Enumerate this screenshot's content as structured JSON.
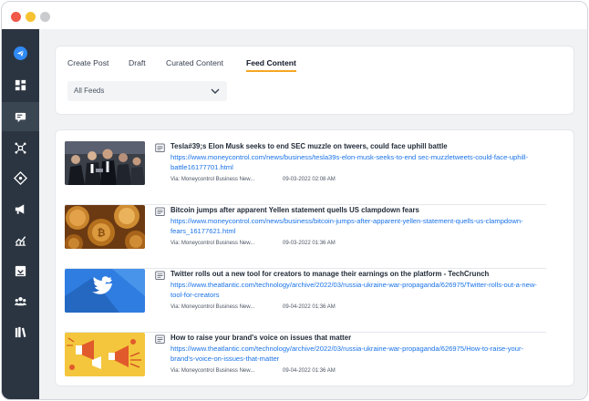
{
  "sidebar": {
    "items": [
      {
        "icon": "paper-plane-icon"
      },
      {
        "icon": "dashboard-icon"
      },
      {
        "icon": "content-icon"
      },
      {
        "icon": "network-icon"
      },
      {
        "icon": "move-icon"
      },
      {
        "icon": "megaphone-icon"
      },
      {
        "icon": "analytics-icon"
      },
      {
        "icon": "inbox-icon"
      },
      {
        "icon": "team-icon"
      },
      {
        "icon": "library-icon"
      }
    ]
  },
  "tabs": [
    {
      "label": "Create Post"
    },
    {
      "label": "Draft"
    },
    {
      "label": "Curated Content"
    },
    {
      "label": "Feed Content"
    }
  ],
  "active_tab": "Feed Content",
  "filter": {
    "selected": "All Feeds"
  },
  "feed": [
    {
      "title": "Tesla#39;s Elon Musk seeks to end SEC muzzle on tweers, could face uphill battle",
      "url": "https://www.moneycontrol.com/news/business/tesla39s-elon-musk-seeks-to-end sec-muzzletweets-could-face-uphill-battle16177701.html",
      "source": "Via: Moneycontrol Business New...",
      "date": "09-03-2022 02:08 AM"
    },
    {
      "title": "Bitcoin jumps after apparent Yellen statement quells US clampdown fears",
      "url": "https://www.moneycontrol.com/news/business/bitcoin-jumps-after-apparent-yellen-statement-quells-us-clampdown-fears_16177621.html",
      "source": "Via: Moneycontrol Business New...",
      "date": "09-03-2022 01:36 AM"
    },
    {
      "title": "Twitter rolls out a new tool for creators to manage their earnings on the platform - TechCrunch",
      "url": "https://www.theatlantic.com/technology/archive/2022/03/russia-ukraine-war-propaganda/626975/Twitter-rolls-out-a-new-tool-for-creators",
      "source": "Via: Moneycontrol Business New...",
      "date": "09-04-2022 01:36 AM"
    },
    {
      "title": "How to raise your brand's voice on issues that matter",
      "url": "https://www.theatlantic.com/technology/archive/2022/03/russia-ukraine-war-propaganda/626975/How-to-raise-your-brand's-voice-on-issues-that-matter",
      "source": "Via: Moneycontrol Business New...",
      "date": "09-04-2022 01:36 AM"
    }
  ]
}
